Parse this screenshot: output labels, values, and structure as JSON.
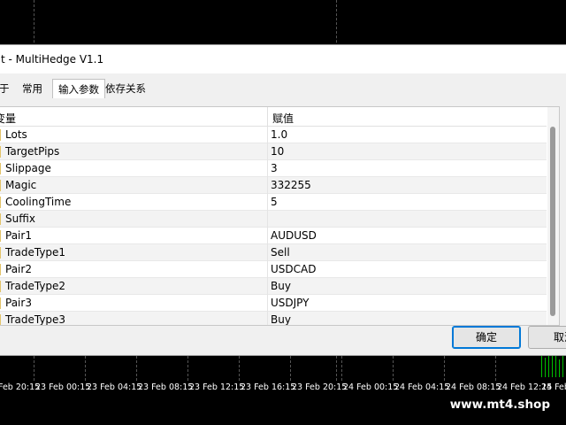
{
  "window": {
    "title": "t - MultiHedge V1.1"
  },
  "tabs": [
    {
      "label": "于"
    },
    {
      "label": "常用"
    },
    {
      "label": "输入参数"
    },
    {
      "label": "依存关系"
    }
  ],
  "table": {
    "columns": [
      "变量",
      "赋值"
    ],
    "rows": [
      {
        "name": "Lots",
        "value": "1.0"
      },
      {
        "name": "TargetPips",
        "value": "10"
      },
      {
        "name": "Slippage",
        "value": "3"
      },
      {
        "name": "Magic",
        "value": "332255"
      },
      {
        "name": "CoolingTime",
        "value": "5"
      },
      {
        "name": "Suffix",
        "value": ""
      },
      {
        "name": "Pair1",
        "value": "AUDUSD"
      },
      {
        "name": "TradeType1",
        "value": "Sell"
      },
      {
        "name": "Pair2",
        "value": "USDCAD"
      },
      {
        "name": "TradeType2",
        "value": "Buy"
      },
      {
        "name": "Pair3",
        "value": "USDJPY"
      },
      {
        "name": "TradeType3",
        "value": "Buy"
      }
    ]
  },
  "buttons": {
    "ok": "确定",
    "cancel": "取消"
  },
  "chart_axis": {
    "time_labels": [
      "Feb 20:15",
      "23 Feb 00:15",
      "23 Feb 04:15",
      "23 Feb 08:15",
      "23 Feb 12:15",
      "23 Feb 16:15",
      "23 Feb 20:15",
      "24 Feb 00:15",
      "24 Feb 04:15",
      "24 Feb 08:15",
      "24 Feb 12:15",
      "24 Feb"
    ]
  },
  "watermark": "www.mt4.shop",
  "colors": {
    "chart_bg": "#000000",
    "accent_button": "#0078d7",
    "param_marker": "#e2c36a",
    "candle": "#00c000"
  }
}
